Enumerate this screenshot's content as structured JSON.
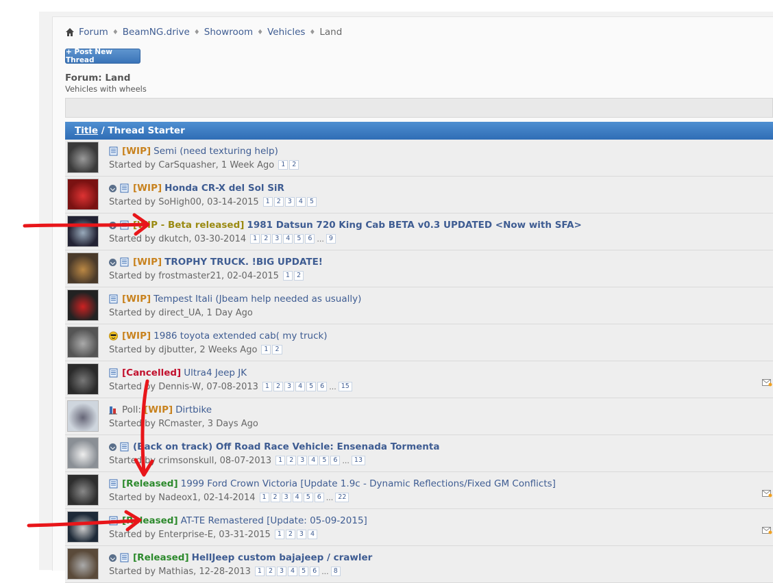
{
  "breadcrumb": {
    "items": [
      "Forum",
      "BeamNG.drive",
      "Showroom",
      "Vehicles",
      "Land"
    ]
  },
  "post_button": "+ Post New Thread",
  "forum": {
    "title": "Forum: Land",
    "description": "Vehicles with wheels"
  },
  "header": {
    "title_link": "Title",
    "rest": " / Thread Starter"
  },
  "threads": [
    {
      "prefix": "[WIP]",
      "title": "Semi (need texturing help)",
      "meta": "Started by CarSquasher, 1 Week Ago",
      "pages": [
        "1",
        "2"
      ]
    },
    {
      "prefix": "[WIP]",
      "title": "Honda CR-X del Sol SiR",
      "meta": "Started by SoHigh00, 03-14-2015",
      "pages": [
        "1",
        "2",
        "3",
        "4",
        "5"
      ]
    },
    {
      "prefix": "[WIP - Beta released]",
      "title": "1981 Datsun 720 King Cab BETA v0.3 UPDATED <Now with SFA>",
      "meta": "Started by dkutch, 03-30-2014",
      "pages": [
        "1",
        "2",
        "3",
        "4",
        "5",
        "6"
      ],
      "last_page": "9"
    },
    {
      "prefix": "[WIP]",
      "title": "TROPHY TRUCK. !BIG UPDATE!",
      "meta": "Started by frostmaster21, 02-04-2015",
      "pages": [
        "1",
        "2"
      ]
    },
    {
      "prefix": "[WIP]",
      "title": "Tempest Itali (Jbeam help needed as usually)",
      "meta": "Started by direct_UA, 1 Day Ago",
      "pages": []
    },
    {
      "prefix": "[WIP]",
      "title": "1986 toyota extended cab( my truck)",
      "meta": "Started by djbutter, 2 Weeks Ago",
      "pages": [
        "1",
        "2"
      ]
    },
    {
      "prefix": "[Cancelled]",
      "title": "Ultra4 Jeep JK",
      "meta": "Started by Dennis-W, 07-08-2013",
      "pages": [
        "1",
        "2",
        "3",
        "4",
        "5",
        "6"
      ],
      "last_page": "15"
    },
    {
      "poll_label": "Poll:",
      "prefix": "[WIP]",
      "title": "Dirtbike",
      "meta": "Started by RCmaster, 3 Days Ago",
      "pages": []
    },
    {
      "prefix": "",
      "title": "(Back on track) Off Road Race Vehicle: Ensenada Tormenta",
      "meta": "Started by crimsonskull, 08-07-2013",
      "pages": [
        "1",
        "2",
        "3",
        "4",
        "5",
        "6"
      ],
      "last_page": "13"
    },
    {
      "prefix": "[Released]",
      "title": "1999 Ford Crown Victoria [Update 1.9c - Dynamic Reflections/Fixed GM Conflicts]",
      "meta": "Started by Nadeox1, 02-14-2014",
      "pages": [
        "1",
        "2",
        "3",
        "4",
        "5",
        "6"
      ],
      "last_page": "22"
    },
    {
      "prefix": "[Released]",
      "title": "AT-TE Remastered [Update: 05-09-2015]",
      "meta": "Started by Enterprise-E, 03-31-2015",
      "pages": [
        "1",
        "2",
        "3",
        "4"
      ]
    },
    {
      "prefix": "[Released]",
      "title": "HellJeep custom bajajeep / crawler",
      "meta": "Started by Mathias, 12-28-2013",
      "pages": [
        "1",
        "2",
        "3",
        "4",
        "5",
        "6"
      ],
      "last_page": "8"
    }
  ],
  "colors": {
    "link": "#3e5c92",
    "wip": "#c8821e",
    "cancelled": "#c2102d",
    "released": "#2d8a2d",
    "header": "#3a78be",
    "annotation": "#e8161a"
  }
}
